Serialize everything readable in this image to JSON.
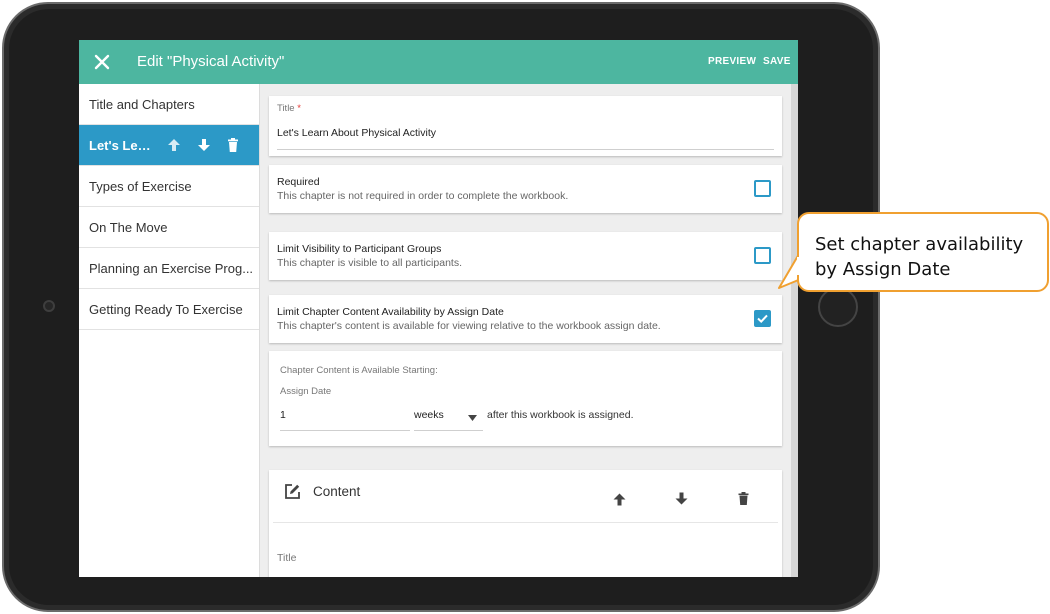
{
  "header": {
    "title": "Edit \"Physical Activity\"",
    "preview_label": "PREVIEW",
    "save_label": "SAVE"
  },
  "sidebar": {
    "items": [
      {
        "label": "Title and Chapters"
      },
      {
        "label": "Let's Learn About Physical Activity",
        "display": "Let's Lea..."
      },
      {
        "label": "Types of Exercise"
      },
      {
        "label": "On The Move"
      },
      {
        "label": "Planning an Exercise Prog..."
      },
      {
        "label": "Getting Ready To Exercise"
      }
    ]
  },
  "title_field": {
    "label": "Title",
    "required_mark": "*",
    "value": "Let's Learn About Physical Activity"
  },
  "options": [
    {
      "title": "Required",
      "description": "This chapter is not required in order to complete the workbook.",
      "checked": false
    },
    {
      "title": "Limit Visibility to Participant Groups",
      "description": "This chapter is visible to all participants.",
      "checked": false
    },
    {
      "title": "Limit Chapter Content Availability by Assign Date",
      "description": "This chapter's content is available for viewing relative to the workbook assign date.",
      "checked": true
    }
  ],
  "availability": {
    "heading": "Chapter Content is Available Starting:",
    "assign_label": "Assign Date",
    "amount": "1",
    "unit": "weeks",
    "suffix": "after this workbook is assigned."
  },
  "content_section": {
    "title": "Content",
    "field_label": "Title"
  },
  "callout": {
    "line1": "Set chapter availability",
    "line2": "by Assign Date"
  },
  "colors": {
    "header": "#4db6a0",
    "accent": "#2c99c7",
    "callout_border": "#f0a030"
  }
}
